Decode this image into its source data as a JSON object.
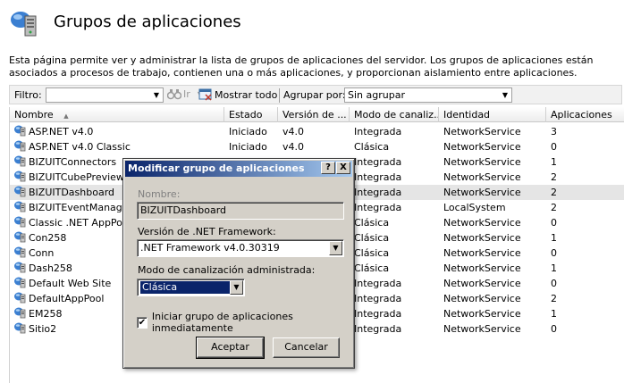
{
  "header": {
    "title": "Grupos de aplicaciones",
    "icon": "app-pools-icon"
  },
  "description": "Esta página permite ver y administrar la lista de grupos de aplicaciones del servidor. Los grupos de aplicaciones están asociados a procesos de trabajo, contienen una o más aplicaciones, y proporcionan aislamiento entre aplicaciones.",
  "toolbar": {
    "filter_label": "Filtro:",
    "filter_value": "",
    "go_label": "Ir",
    "show_all_label": "Mostrar todo",
    "group_by_label": "Agrupar por:",
    "group_by_value": "Sin agrupar"
  },
  "columns": [
    "Nombre",
    "Estado",
    "Versión de ...",
    "Modo de canaliz...",
    "Identidad",
    "Aplicaciones"
  ],
  "rows": [
    {
      "name": "ASP.NET v4.0",
      "state": "Iniciado",
      "version": "v4.0",
      "mode": "Integrada",
      "identity": "NetworkService",
      "apps": "3"
    },
    {
      "name": "ASP.NET v4.0 Classic",
      "state": "Iniciado",
      "version": "v4.0",
      "mode": "Clásica",
      "identity": "NetworkService",
      "apps": "0"
    },
    {
      "name": "BIZUITConnectors",
      "state": "",
      "version": "",
      "mode": "Integrada",
      "identity": "NetworkService",
      "apps": "1"
    },
    {
      "name": "BIZUITCubePreview",
      "state": "",
      "version": "",
      "mode": "Integrada",
      "identity": "NetworkService",
      "apps": "2"
    },
    {
      "name": "BIZUITDashboard",
      "state": "",
      "version": "",
      "mode": "Integrada",
      "identity": "NetworkService",
      "apps": "2"
    },
    {
      "name": "BIZUITEventManager",
      "state": "",
      "version": "",
      "mode": "Integrada",
      "identity": "LocalSystem",
      "apps": "2"
    },
    {
      "name": "Classic .NET AppPool",
      "state": "",
      "version": "",
      "mode": "Clásica",
      "identity": "NetworkService",
      "apps": "0"
    },
    {
      "name": "Con258",
      "state": "",
      "version": "",
      "mode": "Clásica",
      "identity": "NetworkService",
      "apps": "1"
    },
    {
      "name": "Conn",
      "state": "",
      "version": "",
      "mode": "Clásica",
      "identity": "NetworkService",
      "apps": "0"
    },
    {
      "name": "Dash258",
      "state": "",
      "version": "",
      "mode": "Clásica",
      "identity": "NetworkService",
      "apps": "1"
    },
    {
      "name": "Default Web Site",
      "state": "",
      "version": "",
      "mode": "Integrada",
      "identity": "NetworkService",
      "apps": "0"
    },
    {
      "name": "DefaultAppPool",
      "state": "",
      "version": "",
      "mode": "Integrada",
      "identity": "NetworkService",
      "apps": "2"
    },
    {
      "name": "EM258",
      "state": "",
      "version": "",
      "mode": "Integrada",
      "identity": "NetworkService",
      "apps": "1"
    },
    {
      "name": "Sitio2",
      "state": "",
      "version": "",
      "mode": "Integrada",
      "identity": "NetworkService",
      "apps": "0"
    }
  ],
  "selected_row": 4,
  "dialog": {
    "title": "Modificar grupo de aplicaciones",
    "help_label": "?",
    "close_label": "X",
    "name_label": "Nombre:",
    "name_value": "BIZUITDashboard",
    "framework_label": "Versión de .NET Framework:",
    "framework_value": ".NET Framework v4.0.30319",
    "pipeline_label": "Modo de canalización administrada:",
    "pipeline_value": "Clásica",
    "start_label": "Iniciar grupo de aplicaciones inmediatamente",
    "start_checked": "✔",
    "ok_label": "Aceptar",
    "cancel_label": "Cancelar"
  },
  "colors": {
    "title_bar_start": "#0a246a",
    "title_bar_end": "#a6caf0",
    "selection": "#0a246a",
    "selected_row": "#e5e5e5"
  }
}
